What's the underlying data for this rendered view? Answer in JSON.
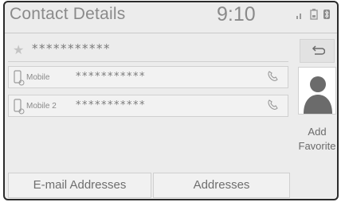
{
  "header": {
    "title": "Contact Details",
    "time": "9:10",
    "status_icons": [
      "signal-bars-icon",
      "battery-icon",
      "bluetooth-icon"
    ]
  },
  "contact": {
    "favorite_icon": "star-icon",
    "name": "***********"
  },
  "numbers": [
    {
      "type": "Mobile",
      "number": "***********",
      "icon": "mobile-phone-icon",
      "call_icon": "call-icon"
    },
    {
      "type": "Mobile 2",
      "number": "***********",
      "icon": "mobile-phone-icon",
      "call_icon": "call-icon"
    }
  ],
  "side": {
    "back_icon": "back-arrow-icon",
    "avatar_icon": "person-silhouette-icon",
    "add_favorite_line1": "Add",
    "add_favorite_line2": "Favorite"
  },
  "bottom": {
    "email_label": "E-mail Addresses",
    "addresses_label": "Addresses"
  },
  "colors": {
    "background": "#ececec",
    "text": "#8a8a8a",
    "frame": "#2b2b2b"
  }
}
